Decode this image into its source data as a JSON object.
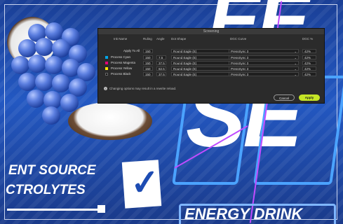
{
  "background": {
    "big_letters_top": "EE",
    "big_letters_bottom": "SE",
    "promo_line1": "ENT SOURCE",
    "promo_line2": "CTROLYTES",
    "checkmark": "✓",
    "energy_text": "ENERGY DRINK",
    "colors": {
      "blue": "#2358c2",
      "accent_outline": "#4ba3ff",
      "guide": "#c04cff"
    }
  },
  "dialog": {
    "title": "Screening",
    "headers": {
      "ink_name": "Ink Name",
      "ruling": "Ruling",
      "angle": "Angle",
      "dot_shape": "Dot Shape",
      "dgc_curve": "DGC Curve",
      "dgc_pct": "DGC %"
    },
    "apply_all": {
      "label": "Apply To All",
      "ruling": "150",
      "dot": "Round Eagle (E)",
      "curve": "PressSync 3",
      "pct": "42%"
    },
    "rows": [
      {
        "ink": "Process Cyan",
        "color": "#00a6e8",
        "ruling": "150",
        "angle": "7.5",
        "dot": "Round Eagle (E)",
        "curve": "PressSync 3",
        "pct": "42%"
      },
      {
        "ink": "Process Magenta",
        "color": "#e4007c",
        "ruling": "150",
        "angle": "37.5",
        "dot": "Round Eagle (E)",
        "curve": "PressSync 3",
        "pct": "42%"
      },
      {
        "ink": "Process Yellow",
        "color": "#ffe600",
        "ruling": "150",
        "angle": "82.5",
        "dot": "Round Eagle (E)",
        "curve": "PressSync 3",
        "pct": "42%"
      },
      {
        "ink": "Process Black",
        "color": "#111111",
        "ruling": "150",
        "angle": "37.5",
        "dot": "Round Eagle (E)",
        "curve": "PressSync 3",
        "pct": "42%"
      }
    ],
    "note": "Changing options may result in a rewrite reload.",
    "cancel_label": "Cancel",
    "apply_label": "Apply"
  }
}
